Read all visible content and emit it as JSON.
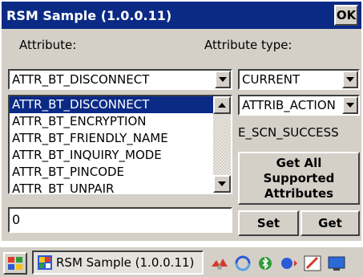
{
  "window": {
    "title": "RSM Sample (1.0.0.11)",
    "ok_label": "OK"
  },
  "labels": {
    "attribute": "Attribute:",
    "attribute_type": "Attribute type:"
  },
  "attribute_combo": {
    "value": "ATTR_BT_DISCONNECT"
  },
  "type_combo": {
    "value": "CURRENT"
  },
  "action_combo": {
    "value": "ATTRIB_ACTION"
  },
  "attribute_list": {
    "items": [
      "ATTR_BT_DISCONNECT",
      "ATTR_BT_ENCRYPTION",
      "ATTR_BT_FRIENDLY_NAME",
      "ATTR_BT_INQUIRY_MODE",
      "ATTR_BT_PINCODE",
      "ATTR_BT_UNPAIR"
    ],
    "selected_index": 0
  },
  "status": {
    "text": "E_SCN_SUCCESS"
  },
  "buttons": {
    "get_all": "Get All Supported Attributes",
    "set": "Set",
    "get": "Get"
  },
  "value_input": {
    "value": "0"
  },
  "taskbar": {
    "task_label": "RSM Sample (1.0.0.11)"
  },
  "colors": {
    "titlebar": "#0a2a86",
    "selection": "#0a2a86",
    "face": "#d4d0c8"
  },
  "icons": [
    "windows-flag-icon",
    "app-icon",
    "network-icon",
    "sync-icon",
    "bluetooth-icon",
    "volume-icon",
    "edit-icon",
    "desktop-icon"
  ]
}
